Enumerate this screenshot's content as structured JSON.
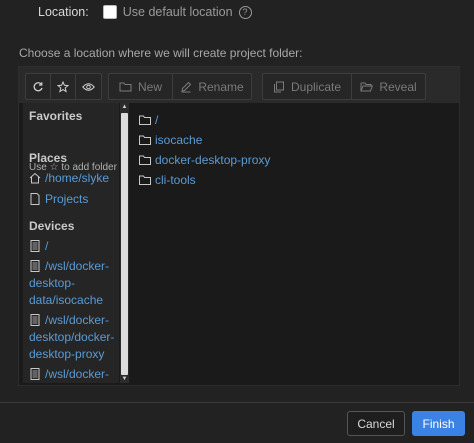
{
  "location": {
    "label": "Location",
    "separator": ":",
    "checkbox_label": "Use default location",
    "checked": false
  },
  "instruction": "Choose a location where we will create project folder:",
  "toolbar": {
    "new_label": "New",
    "rename_label": "Rename",
    "duplicate_label": "Duplicate",
    "reveal_label": "Reveal"
  },
  "sidebar": {
    "favorites_title": "Favorites",
    "favorites_hint_pre": "Use",
    "favorites_hint_post": "to add folder",
    "places_title": "Places",
    "places": [
      {
        "label": "/home/slyke",
        "icon": "home-icon"
      },
      {
        "label": "Projects",
        "icon": "document-icon"
      }
    ],
    "devices_title": "Devices",
    "devices": [
      {
        "line1": "/",
        "line2": "",
        "line3": "",
        "icon": "drive-icon"
      },
      {
        "line1": "/wsl/docker-",
        "line2": "desktop-",
        "line3": "data/isocache",
        "icon": "drive-icon"
      },
      {
        "line1": "/wsl/docker-",
        "line2": "desktop/docker-",
        "line3": "desktop-proxy",
        "icon": "drive-icon"
      },
      {
        "line1": "/wsl/docker-",
        "line2": "",
        "line3": "",
        "icon": "drive-icon"
      }
    ]
  },
  "folders": [
    "/",
    "isocache",
    "docker-desktop-proxy",
    "cli-tools"
  ],
  "footer": {
    "cancel_label": "Cancel",
    "finish_label": "Finish",
    "accent_color": "#3a82e4"
  }
}
